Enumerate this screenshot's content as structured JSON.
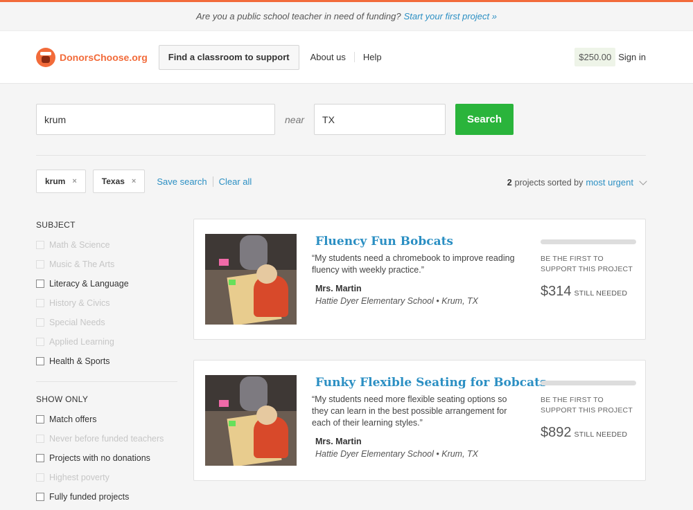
{
  "promo": {
    "text": "Are you a public school teacher in need of funding?",
    "link": "Start your first project »"
  },
  "header": {
    "logo_text": "DonorsChoose.org",
    "find_button": "Find a classroom to support",
    "about": "About us",
    "help": "Help",
    "balance": "$250.00",
    "signin": "Sign in"
  },
  "search": {
    "keyword": "krum",
    "near_label": "near",
    "location": "TX",
    "button": "Search"
  },
  "filters_applied": {
    "chips": [
      "krum",
      "Texas"
    ],
    "chip_remove_icon": "×",
    "save_search": "Save search",
    "clear_all": "Clear all"
  },
  "sort": {
    "count": "2",
    "text": "projects sorted by",
    "option": "most urgent"
  },
  "sidebar": {
    "subject_heading": "SUBJECT",
    "subjects": [
      {
        "label": "Math & Science",
        "enabled": false
      },
      {
        "label": "Music & The Arts",
        "enabled": false
      },
      {
        "label": "Literacy & Language",
        "enabled": true
      },
      {
        "label": "History & Civics",
        "enabled": false
      },
      {
        "label": "Special Needs",
        "enabled": false
      },
      {
        "label": "Applied Learning",
        "enabled": false
      },
      {
        "label": "Health & Sports",
        "enabled": true
      }
    ],
    "show_only_heading": "SHOW ONLY",
    "show_only": [
      {
        "label": "Match offers",
        "enabled": true
      },
      {
        "label": "Never before funded teachers",
        "enabled": false
      },
      {
        "label": "Projects with no donations",
        "enabled": true
      },
      {
        "label": "Highest poverty",
        "enabled": false
      },
      {
        "label": "Fully funded projects",
        "enabled": true
      }
    ]
  },
  "projects": [
    {
      "title": "Fluency Fun Bobcats",
      "quote": "“My students need a chromebook to improve reading fluency with weekly practice.”",
      "teacher": "Mrs. Martin",
      "school": "Hattie Dyer Elementary School • Krum, TX",
      "progress_percent": 0,
      "support_text": "BE THE FIRST TO SUPPORT THIS PROJECT",
      "amount": "$314",
      "still_needed": "STILL NEEDED"
    },
    {
      "title": "Funky Flexible Seating for Bobcats",
      "quote": "“My students need more flexible seating options so they can learn in the best possible arrangement for each of their learning styles.”",
      "teacher": "Mrs. Martin",
      "school": "Hattie Dyer Elementary School • Krum, TX",
      "progress_percent": 0,
      "support_text": "BE THE FIRST TO SUPPORT THIS PROJECT",
      "amount": "$892",
      "still_needed": "STILL NEEDED"
    }
  ],
  "colors": {
    "accent": "#f26b3a",
    "link": "#2b8fc3",
    "search_button": "#2ab43b"
  }
}
